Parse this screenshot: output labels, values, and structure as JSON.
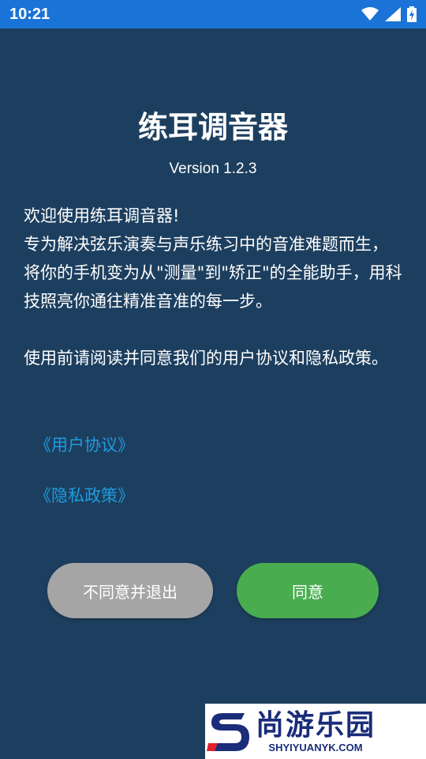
{
  "status_bar": {
    "time": "10:21",
    "icons": [
      "wifi-icon",
      "signal-icon",
      "battery-charging-icon"
    ],
    "bg_color": "#1a73d6"
  },
  "app": {
    "title": "练耳调音器",
    "version": "Version 1.2.3",
    "bg_color": "#1d3f5f"
  },
  "body": {
    "welcome": "欢迎使用练耳调音器!",
    "description": "专为解决弦乐演奏与声乐练习中的音准难题而生，将你的手机变为从\"测量\"到\"矫正\"的全能助手，用科技照亮你通往精准音准的每一步。",
    "notice": "使用前请阅读并同意我们的用户协议和隐私政策。"
  },
  "links": {
    "user_agreement": "《用户协议》",
    "privacy_policy": "《隐私政策》",
    "color": "#1e9cde"
  },
  "buttons": {
    "decline": "不同意并退出",
    "accept": "同意",
    "decline_color": "#a5a5a5",
    "accept_color": "#49ad50"
  },
  "watermark": {
    "name": "尚游乐园",
    "url": "SHYIYUANYK.COM"
  }
}
